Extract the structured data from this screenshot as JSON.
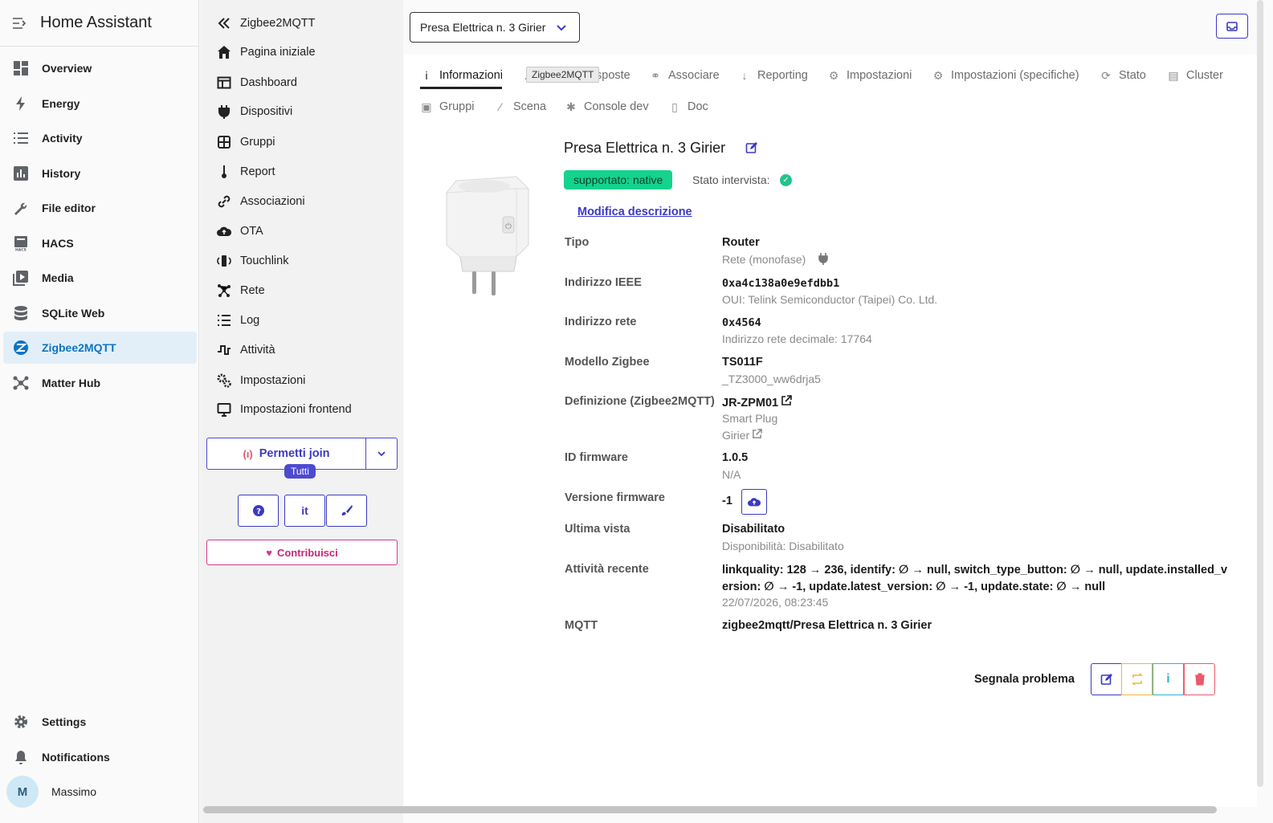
{
  "ha_sidebar": {
    "title": "Home Assistant",
    "items": [
      {
        "label": "Overview",
        "icon": "dashboard-icon"
      },
      {
        "label": "Energy",
        "icon": "lightning-icon"
      },
      {
        "label": "Activity",
        "icon": "list-icon"
      },
      {
        "label": "History",
        "icon": "chart-icon"
      },
      {
        "label": "File editor",
        "icon": "wrench-icon"
      },
      {
        "label": "HACS",
        "icon": "hacs-icon"
      },
      {
        "label": "Media",
        "icon": "media-icon"
      },
      {
        "label": "SQLite Web",
        "icon": "database-icon"
      },
      {
        "label": "Zigbee2MQTT",
        "icon": "zigbee-icon",
        "active": true
      },
      {
        "label": "Matter Hub",
        "icon": "hub-icon"
      }
    ],
    "settings": "Settings",
    "notifications": "Notifications",
    "user": {
      "initial": "M",
      "name": "Massimo"
    }
  },
  "z2m_nav": {
    "back_label": "Zigbee2MQTT",
    "items": [
      {
        "label": "Pagina iniziale",
        "icon": "home-icon"
      },
      {
        "label": "Dashboard",
        "icon": "dashboard-icon"
      },
      {
        "label": "Dispositivi",
        "icon": "plug-icon"
      },
      {
        "label": "Gruppi",
        "icon": "grid-icon"
      },
      {
        "label": "Report",
        "icon": "thermometer-icon"
      },
      {
        "label": "Associazioni",
        "icon": "link-icon"
      },
      {
        "label": "OTA",
        "icon": "cloud-upload-icon"
      },
      {
        "label": "Touchlink",
        "icon": "touchlink-icon"
      },
      {
        "label": "Rete",
        "icon": "network-icon"
      },
      {
        "label": "Log",
        "icon": "list-icon"
      },
      {
        "label": "Attività",
        "icon": "activity-icon"
      },
      {
        "label": "Impostazioni",
        "icon": "cogs-icon"
      },
      {
        "label": "Impostazioni frontend",
        "icon": "monitor-icon"
      }
    ],
    "permit_join": "Permetti join",
    "permit_badge": "Tutti",
    "lang_btn": "it",
    "contribute": "Contribuisci"
  },
  "header": {
    "device_select": "Presa Elettrica n. 3 Girier"
  },
  "tabs": [
    {
      "label": "Informazioni",
      "icon": "info-icon",
      "active": true
    },
    {
      "label": "sposte",
      "icon": "exposes-icon"
    },
    {
      "label": "Associare",
      "icon": "link-icon"
    },
    {
      "label": "Reporting",
      "icon": "thermometer-icon"
    },
    {
      "label": "Impostazioni",
      "icon": "cogs-icon"
    },
    {
      "label": "Impostazioni (specifiche)",
      "icon": "gear-icon"
    },
    {
      "label": "Stato",
      "icon": "refresh-icon"
    },
    {
      "label": "Cluster",
      "icon": "file-icon"
    },
    {
      "label": "Gruppi",
      "icon": "image-icon"
    },
    {
      "label": "Scena",
      "icon": "wand-icon"
    },
    {
      "label": "Console dev",
      "icon": "bug-icon"
    },
    {
      "label": "Doc",
      "icon": "doc-icon"
    }
  ],
  "tooltip": "Zigbee2MQTT",
  "device": {
    "name": "Presa Elettrica n. 3 Girier",
    "support_badge": "supportato: native",
    "interview_label": "Stato intervista:",
    "edit_description": "Modifica descrizione",
    "fields": {
      "type_label": "Tipo",
      "type_value": "Router",
      "type_sub": "Rete (monofase)",
      "ieee_label": "Indirizzo IEEE",
      "ieee_value": "0xa4c138a0e9efdbb1",
      "ieee_sub": "OUI: Telink Semiconductor (Taipei) Co. Ltd.",
      "net_label": "Indirizzo rete",
      "net_value": "0x4564",
      "net_sub": "Indirizzo rete decimale: 17764",
      "model_label": "Modello Zigbee",
      "model_value": "TS011F",
      "model_sub": "_TZ3000_ww6drja5",
      "def_label": "Definizione (Zigbee2MQTT)",
      "def_value": "JR-ZPM01",
      "def_sub1": "Smart Plug",
      "def_sub2": "Girier",
      "fwid_label": "ID firmware",
      "fwid_value": "1.0.5",
      "fwid_sub": "N/A",
      "fwver_label": "Versione firmware",
      "fwver_value": "-1",
      "lastseen_label": "Ultima vista",
      "lastseen_value": "Disabilitato",
      "lastseen_sub": "Disponibilità: Disabilitato",
      "activity_label": "Attività recente",
      "activity_value": "linkquality: 128 → 236, identify: ∅ → null, switch_type_button: ∅ → null, update.installed_version: ∅ → -1, update.latest_version: ∅ → -1, update.state: ∅ → null",
      "activity_time": "22/07/2026, 08:23:45",
      "mqtt_label": "MQTT",
      "mqtt_value": "zigbee2mqtt/Presa Elettrica n. 3 Girier"
    },
    "report_issue": "Segnala problema"
  }
}
